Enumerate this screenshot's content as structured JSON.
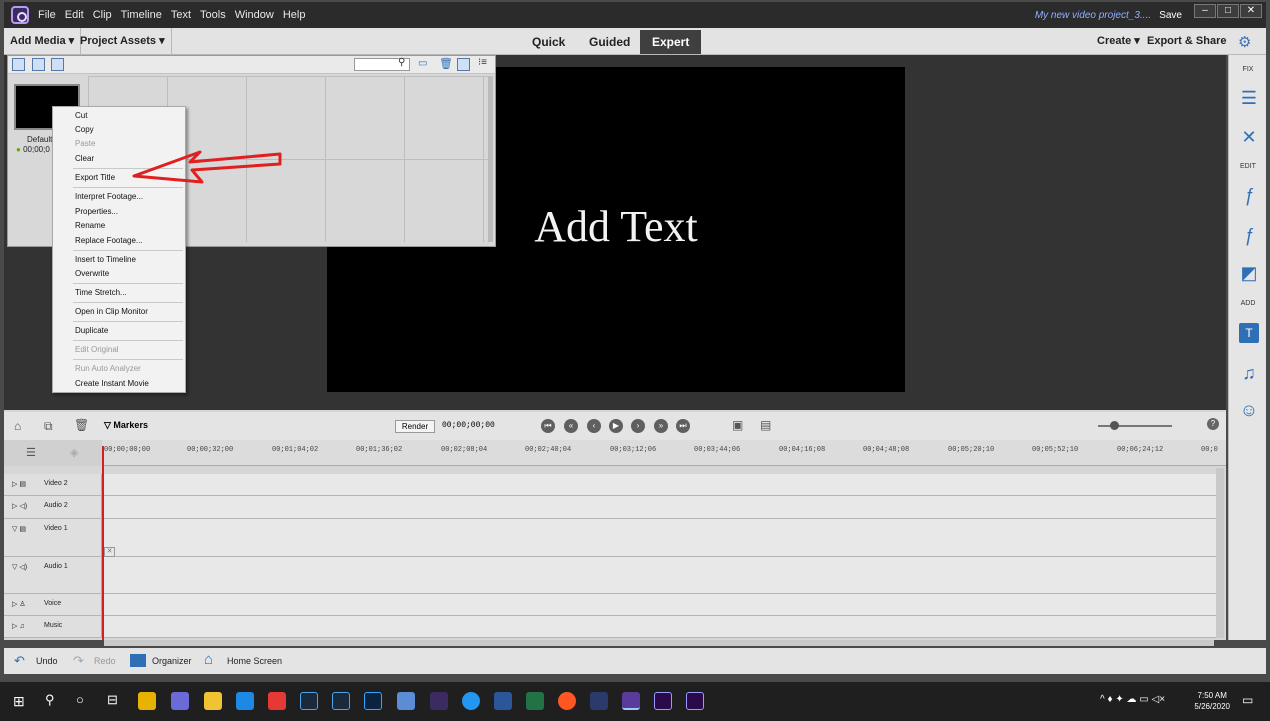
{
  "titlebar": {
    "menus": [
      "File",
      "Edit",
      "Clip",
      "Timeline",
      "Text",
      "Tools",
      "Window",
      "Help"
    ],
    "project": "My new video project_3....",
    "save": "Save"
  },
  "tabbar": {
    "add_media": "Add Media",
    "project_assets": "Project Assets",
    "modes": [
      "Quick",
      "Guided",
      "Expert"
    ],
    "active_mode": "Expert",
    "create": "Create",
    "export_share": "Export & Share"
  },
  "assets": {
    "item_name": "Default",
    "item_time": "00;00;0"
  },
  "monitor": {
    "text": "Add Text"
  },
  "context_menu": {
    "items": [
      {
        "label": "Cut",
        "enabled": true
      },
      {
        "label": "Copy",
        "enabled": true
      },
      {
        "label": "Paste",
        "enabled": false
      },
      {
        "label": "Clear",
        "enabled": true
      },
      {
        "label": "Export Title",
        "enabled": true
      },
      {
        "label": "Interpret Footage...",
        "enabled": true
      },
      {
        "label": "Properties...",
        "enabled": true
      },
      {
        "label": "Rename",
        "enabled": true
      },
      {
        "label": "Replace Footage...",
        "enabled": true
      },
      {
        "label": "Insert to Timeline",
        "enabled": true
      },
      {
        "label": "Overwrite",
        "enabled": true
      },
      {
        "label": "Time Stretch...",
        "enabled": true
      },
      {
        "label": "Open in Clip Monitor",
        "enabled": true
      },
      {
        "label": "Duplicate",
        "enabled": true
      },
      {
        "label": "Edit Original",
        "enabled": false
      },
      {
        "label": "Run Auto Analyzer",
        "enabled": false
      },
      {
        "label": "Create Instant Movie",
        "enabled": true
      }
    ]
  },
  "right_panel": {
    "fix": "FIX",
    "edit": "EDIT",
    "add": "ADD"
  },
  "timeline": {
    "markers": "Markers",
    "render": "Render",
    "timecode": "00;00;00;00",
    "ticks": [
      "00;00;00;00",
      "00;00;32;00",
      "00;01;04;02",
      "00;01;36;02",
      "00;02;08;04",
      "00;02;40;04",
      "00;03;12;06",
      "00;03;44;06",
      "00;04;16;08",
      "00;04;48;08",
      "00;05;20;10",
      "00;05;52;10",
      "00;06;24;12",
      "00;0"
    ],
    "tracks": [
      "Video 2",
      "Audio 2",
      "Video 1",
      "Audio 1",
      "Voice",
      "Music"
    ]
  },
  "bottom": {
    "undo": "Undo",
    "redo": "Redo",
    "organizer": "Organizer",
    "home": "Home Screen"
  },
  "taskbar": {
    "time": "7:50 AM",
    "date": "5/26/2020"
  },
  "colors": {
    "accent": "#2f6fb6",
    "arrow": "#e02020",
    "playhead": "#d02020"
  }
}
